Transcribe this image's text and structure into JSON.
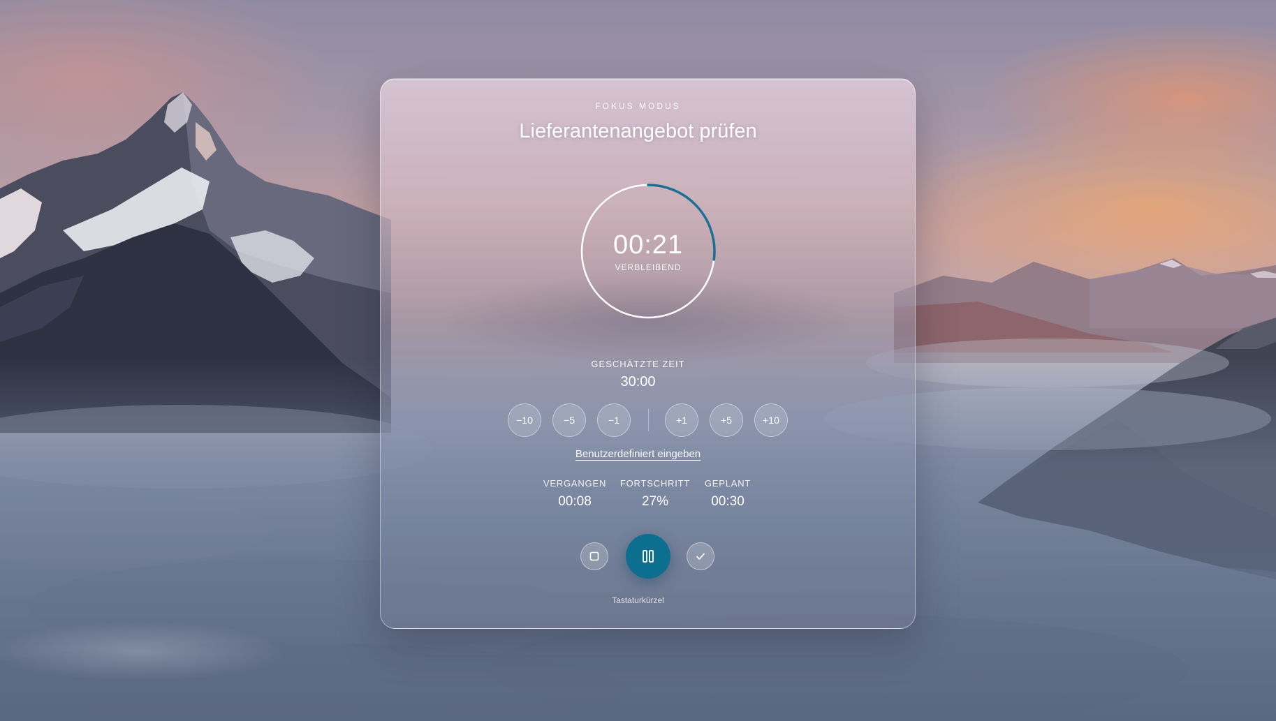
{
  "mode_label": "FOKUS MODUS",
  "task_title": "Lieferantenangebot prüfen",
  "timer": {
    "remaining": "00:21",
    "remaining_label": "VERBLEIBEND",
    "progress_fraction": 0.27
  },
  "estimate": {
    "label": "GESCHÄTZTE ZEIT",
    "value": "30:00"
  },
  "adjust_buttons": [
    "−10",
    "−5",
    "−1",
    "+1",
    "+5",
    "+10"
  ],
  "custom_entry_label": "Benutzerdefiniert eingeben",
  "stats": [
    {
      "label": "VERGANGEN",
      "value": "00:08"
    },
    {
      "label": "FORTSCHRITT",
      "value": "27%"
    },
    {
      "label": "GEPLANT",
      "value": "00:30"
    }
  ],
  "controls": {
    "stop_icon": "stop-icon",
    "pause_icon": "pause-icon",
    "complete_icon": "checkmark-icon"
  },
  "shortcuts_label": "Tastaturkürzel",
  "colors": {
    "accent": "#0c6f8f",
    "ring_progress": "#1a6f93",
    "ring_track": "#ffffff"
  }
}
